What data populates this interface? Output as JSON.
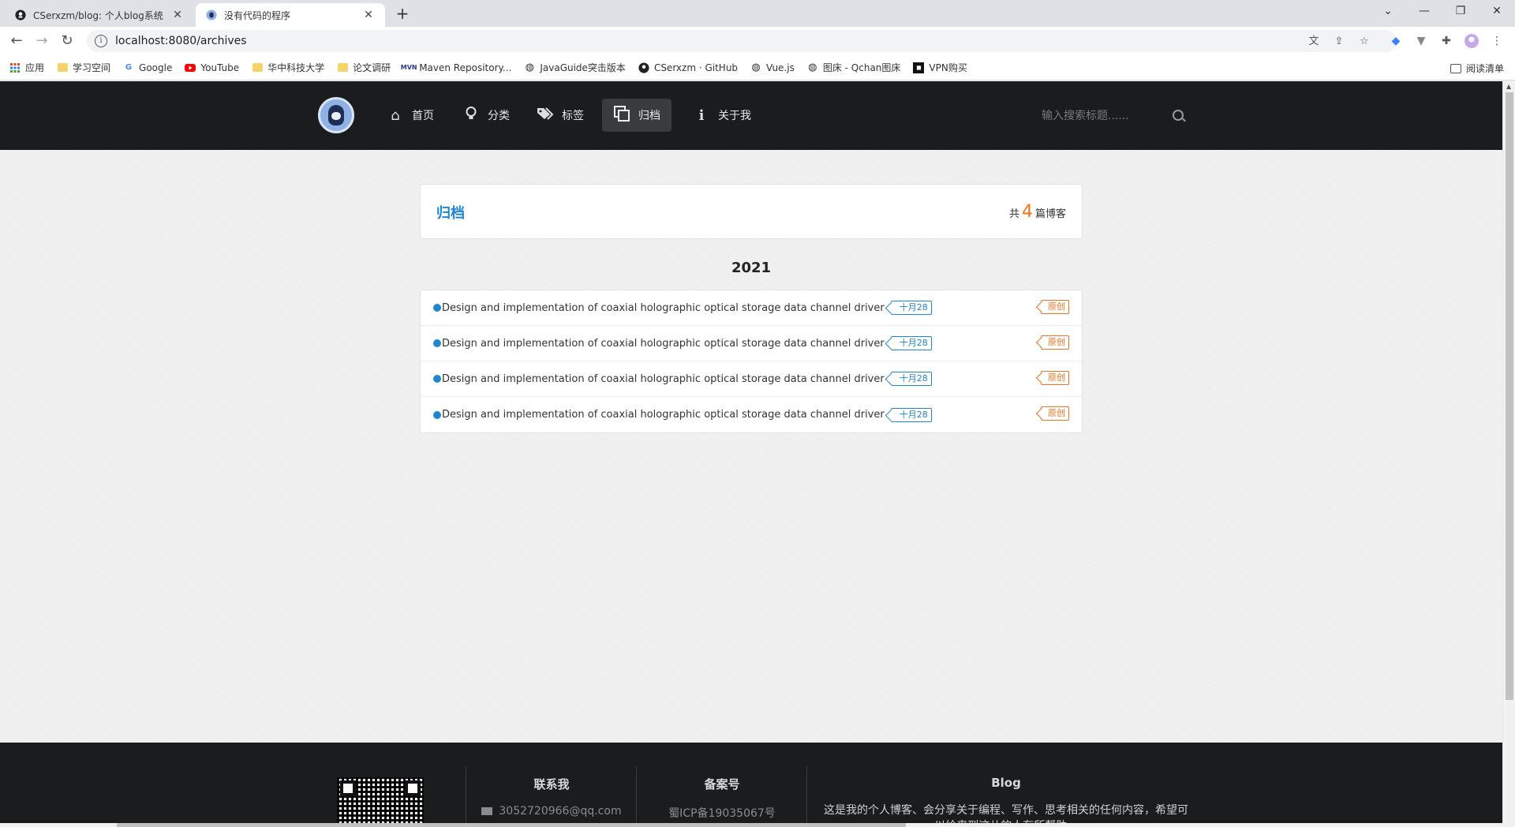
{
  "browser": {
    "tabs": [
      {
        "title": "CSerxzm/blog: 个人blog系统",
        "icon": "github-icon",
        "active": false
      },
      {
        "title": "没有代码的程序",
        "icon": "site-icon",
        "active": true
      }
    ],
    "url": "localhost:8080/archives",
    "bookmarks": [
      {
        "label": "应用",
        "icon": "apps-grid-icon"
      },
      {
        "label": "学习空间",
        "icon": "folder-icon"
      },
      {
        "label": "Google",
        "icon": "google-icon"
      },
      {
        "label": "YouTube",
        "icon": "youtube-icon"
      },
      {
        "label": "华中科技大学",
        "icon": "folder-icon"
      },
      {
        "label": "论文调研",
        "icon": "folder-icon"
      },
      {
        "label": "Maven Repository...",
        "icon": "maven-icon"
      },
      {
        "label": "JavaGuide突击版本",
        "icon": "globe-icon"
      },
      {
        "label": "CSerxzm · GitHub",
        "icon": "github-icon"
      },
      {
        "label": "Vue.js",
        "icon": "globe-icon"
      },
      {
        "label": "图床 - Qchan图床",
        "icon": "globe-icon"
      },
      {
        "label": "VPN购买",
        "icon": "vpn-icon"
      }
    ],
    "reading_list": "阅读清单"
  },
  "nav": {
    "items": [
      {
        "label": "首页",
        "icon": "home-icon",
        "active": false
      },
      {
        "label": "分类",
        "icon": "lightbulb-icon",
        "active": false
      },
      {
        "label": "标签",
        "icon": "tags-icon",
        "active": false
      },
      {
        "label": "归档",
        "icon": "clone-icon",
        "active": true
      },
      {
        "label": "关于我",
        "icon": "info-icon",
        "active": false
      }
    ],
    "search_placeholder": "输入搜索标题......"
  },
  "archive": {
    "heading": "归档",
    "count_prefix": "共",
    "count": "4",
    "count_suffix": "篇博客",
    "year": "2021",
    "posts": [
      {
        "title": "Design and implementation of coaxial holographic optical storage data channel driver",
        "date": "十月28",
        "badge": "原创"
      },
      {
        "title": "Design and implementation of coaxial holographic optical storage data channel driver",
        "date": "十月28",
        "badge": "原创"
      },
      {
        "title": "Design and implementation of coaxial holographic optical storage data channel driver",
        "date": "十月28",
        "badge": "原创"
      },
      {
        "title": "Design and implementation of coaxial holographic optical storage data channel driver",
        "date": "十月28",
        "badge": "原创"
      }
    ]
  },
  "footer": {
    "contact_title": "联系我",
    "email": "3052720966@qq.com",
    "record_title": "备案号",
    "record": "蜀ICP备19035067号",
    "blog_title": "Blog",
    "blog_desc": "这是我的个人博客、会分享关于编程、写作、思考相关的任何内容，希望可以给来到这儿的人有所帮助..."
  },
  "colors": {
    "accent_blue": "#2185d0",
    "accent_orange": "#f2711c",
    "nav_bg": "#1b1c1d"
  }
}
